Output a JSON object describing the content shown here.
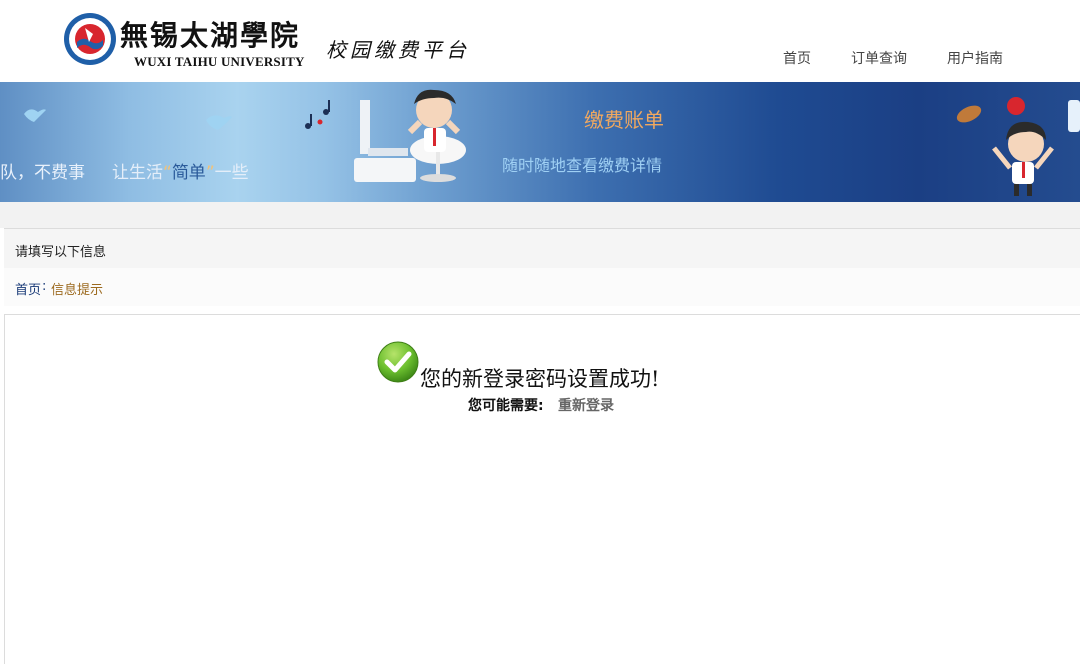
{
  "header": {
    "logo_cn": "無锡太湖學院",
    "logo_en": "WUXI TAIHU UNIVERSITY",
    "platform": "校园缴费平台",
    "nav": {
      "home": "首页",
      "orders": "订单查询",
      "guide": "用户指南"
    }
  },
  "banner": {
    "slogan_left": "队，不费事",
    "slogan_prefix": "让生活",
    "slogan_quote_open": "“",
    "slogan_highlight": "简单",
    "slogan_quote_close": "”",
    "slogan_suffix": "一些",
    "title": "缴费账单",
    "subtitle": "随时随地查看缴费详情"
  },
  "panel": {
    "title": "请填写以下信息",
    "breadcrumb": {
      "home": "首页",
      "separator": ":",
      "current": "信息提示"
    }
  },
  "result": {
    "icon": "check-icon",
    "message": "您的新登录密码设置成功!",
    "hint_label": "您可能需要:",
    "relogin": "重新登录"
  },
  "colors": {
    "success_green": "#6cbf2f",
    "banner_title": "#f0a860",
    "crumb_current": "#9c6a1f",
    "crumb_link": "#1a3b78"
  }
}
